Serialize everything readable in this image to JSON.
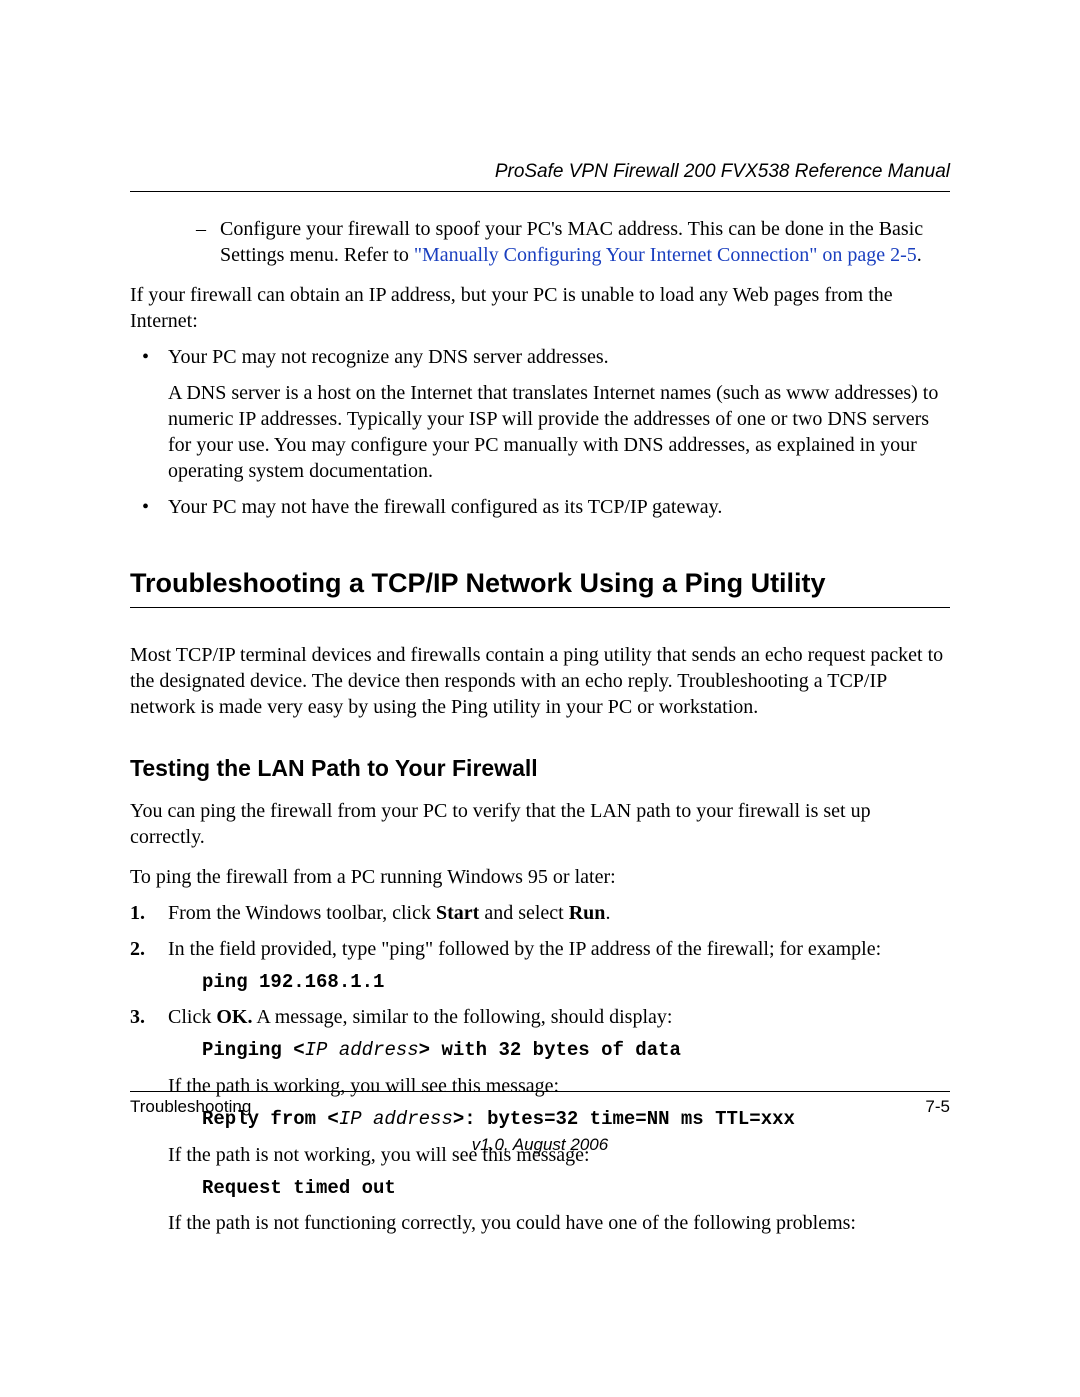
{
  "header": "ProSafe VPN Firewall 200 FVX538 Reference Manual",
  "dash1_pre": "Configure your firewall to spoof your PC's MAC address. This can be done in the Basic Settings menu. Refer to ",
  "dash1_link": "\"Manually Configuring Your Internet Connection\" on page 2-5",
  "dash1_post": ".",
  "p_if": "If your firewall can obtain an IP address, but your PC is unable to load any Web pages from the Internet:",
  "bullet1": "Your PC may not recognize any DNS server addresses.",
  "bullet1_sub": "A DNS server is a host on the Internet that translates Internet names (such as www addresses) to numeric IP addresses. Typically your ISP will provide the addresses of one or two DNS servers for your use. You may configure your PC manually with DNS addresses, as explained in your operating system documentation.",
  "bullet2": "Your PC may not have the firewall configured as its TCP/IP gateway.",
  "section_heading": "Troubleshooting a TCP/IP Network Using a Ping Utility",
  "section_p": "Most TCP/IP terminal devices and firewalls contain a ping utility that sends an echo request packet to the designated device. The device then responds with an echo reply. Troubleshooting a TCP/IP network is made very easy by using the Ping utility in your PC or workstation.",
  "sub_heading": "Testing the LAN Path to Your Firewall",
  "sub_p1": "You can ping the firewall from your PC to verify that the LAN path to your firewall is set up correctly.",
  "sub_p2": "To ping the firewall from a PC running Windows 95 or later:",
  "ol1_num": "1.",
  "ol1_a": "From the Windows toolbar, click ",
  "ol1_b": "Start",
  "ol1_c": " and select ",
  "ol1_d": "Run",
  "ol1_e": ".",
  "ol2_num": "2.",
  "ol2": "In the field provided, type \"ping\" followed by the IP address of the firewall; for example:",
  "code1": "ping 192.168.1.1",
  "ol3_num": "3.",
  "ol3_a": "Click ",
  "ol3_b": "OK.",
  "ol3_c": " A message, similar to the following, should display:",
  "code2_a": "Pinging <",
  "code2_b": "IP address",
  "code2_c": "> with 32 bytes of data",
  "indent1": "If the path is working, you will see this message:",
  "code3_a": "Reply from <",
  "code3_b": "IP address",
  "code3_c": ">: bytes=32 time=NN ms TTL=xxx",
  "indent2": "If the path is not working, you will see this message:",
  "code4": "Request timed out",
  "indent3": "If the path is not functioning correctly, you could have one of the following problems:",
  "footer_left": "Troubleshooting",
  "footer_right": "7-5",
  "footer_version": "v1.0, August 2006"
}
